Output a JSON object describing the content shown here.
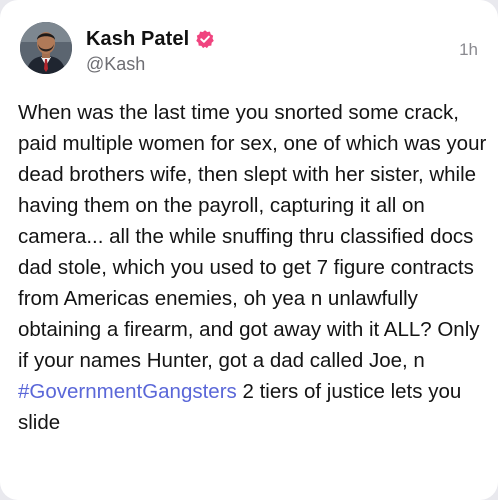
{
  "post": {
    "author": {
      "display_name": "Kash Patel",
      "handle": "@Kash",
      "verified": true,
      "verified_icon": "verified-badge-icon",
      "verified_color": "#f0447f"
    },
    "timestamp": "1h",
    "body": {
      "text_before": "When was the last time you snorted some crack, paid multiple women for sex, one of which was your dead brothers wife, then slept with her sister, while having them on the payroll, capturing it all on camera... all the while snuffing thru classified docs dad stole, which you used to get 7 figure contracts from Americas enemies, oh yea n unlawfully obtaining a firearm, and got away with it ALL? Only if your names Hunter, got a dad called Joe, n ",
      "hashtag": "#GovernmentGangsters",
      "text_after": " 2 tiers of justice lets you slide"
    }
  },
  "colors": {
    "hashtag": "#5a67d8",
    "background": "#ffffff",
    "secondary_text": "#6e6e73"
  }
}
